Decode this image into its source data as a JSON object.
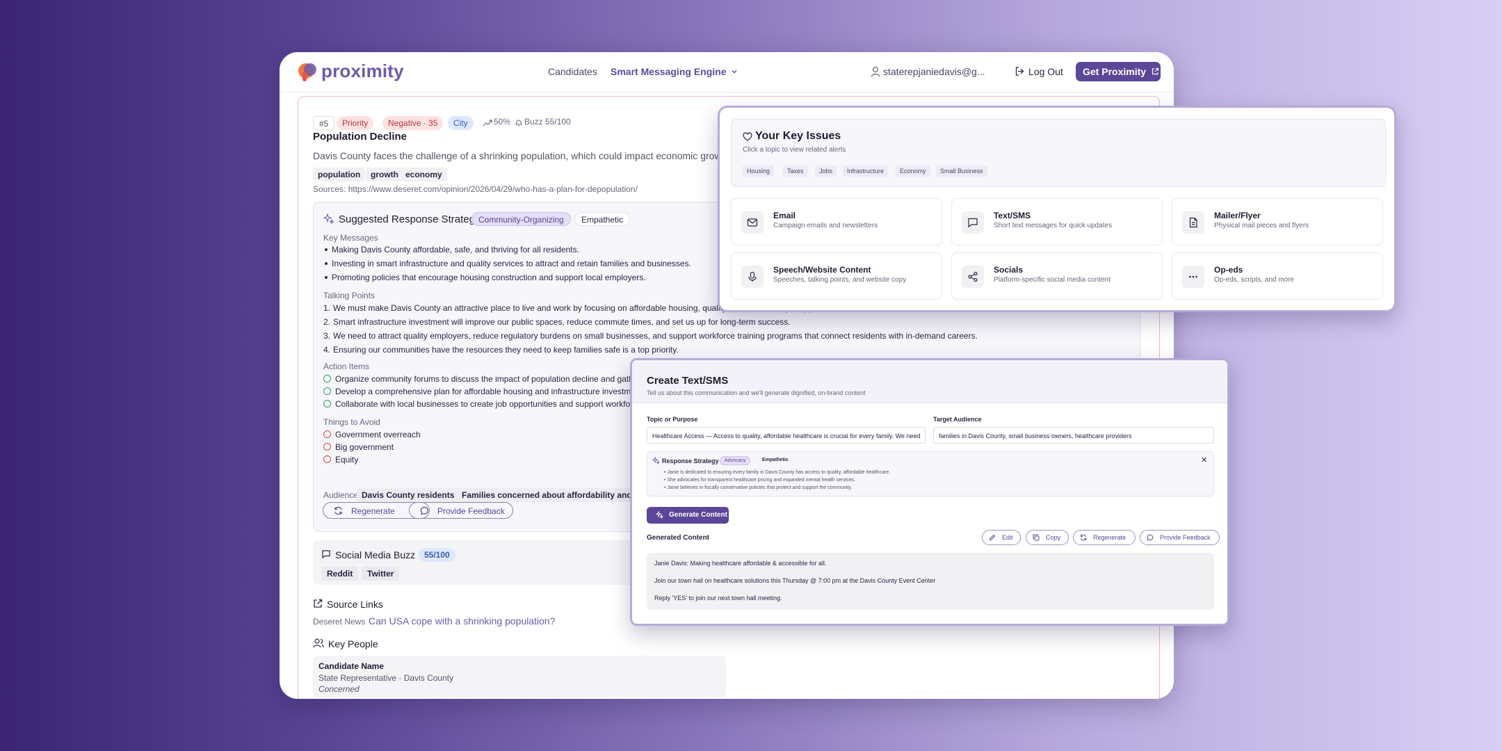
{
  "nav": {
    "logo": "proximity",
    "links": [
      "Candidates",
      "Smart Messaging Engine"
    ],
    "user": "staterepjaniedavis@g...",
    "logout": "Log Out",
    "cta": "Get Proximity"
  },
  "issue": {
    "number": "#5",
    "tags": [
      "Priority",
      "Negative · 35",
      "City"
    ],
    "trend": "50%",
    "buzz": "Buzz 55/100",
    "title": "Population Decline",
    "description": "Davis County faces the challenge of a shrinking population, which could impact economic growth",
    "keywords": [
      "population",
      "growth",
      "economy"
    ],
    "sources": "Sources: https://www.deseret.com/opinion/2026/04/29/who-has-a-plan-for-depopulation/"
  },
  "strategy": {
    "title": "Suggested Response Strategy",
    "type": "Community-Organizing",
    "tone": "Empathetic",
    "key_messages_label": "Key Messages",
    "key_messages": [
      "Making Davis County affordable, safe, and thriving for all residents.",
      "Investing in smart infrastructure and quality services to attract and retain families and businesses.",
      "Promoting policies that encourage housing construction and support local employers."
    ],
    "talking_points_label": "Talking Points",
    "talking_points": [
      "We must make Davis County an attractive place to live and work by focusing on affordable housing, quality education, and job opportunities.",
      "Smart infrastructure investment will improve our public spaces, reduce commute times, and set us up for long-term success.",
      "We need to attract quality employers, reduce regulatory burdens on small businesses, and support workforce training programs that connect residents with in-demand careers.",
      "Ensuring our communities have the resources they need to keep families safe is a top priority."
    ],
    "action_items_label": "Action Items",
    "action_items": [
      "Organize community forums to discuss the impact of population decline and gather",
      "Develop a comprehensive plan for affordable housing and infrastructure investment",
      "Collaborate with local businesses to create job opportunities and support workforce"
    ],
    "avoid_label": "Things to Avoid",
    "avoid": [
      "Government overreach",
      "Big government",
      "Equity"
    ],
    "audience_label": "Audience:",
    "audience": [
      "Davis County residents",
      "Families concerned about affordability and safe"
    ],
    "regenerate": "Regenerate",
    "feedback": "Provide Feedback"
  },
  "social": {
    "title": "Social Media Buzz",
    "score": "55/100",
    "platforms": [
      "Reddit",
      "Twitter"
    ]
  },
  "source_links": {
    "title": "Source Links",
    "publisher": "Deseret News",
    "link": "Can USA cope with a shrinking population?"
  },
  "key_people": {
    "title": "Key People",
    "name": "Candidate Name",
    "role": "State Representative · Davis County",
    "stance": "Concerned"
  },
  "key_issues": {
    "title": "Your Key Issues",
    "subtitle": "Click a topic to view related alerts",
    "tags": [
      "Housing",
      "Taxes",
      "Jobs",
      "Infrastructure",
      "Economy",
      "Small Business"
    ],
    "cards": [
      {
        "title": "Email",
        "sub": "Campaign emails and newsletters",
        "icon": "mail-icon"
      },
      {
        "title": "Text/SMS",
        "sub": "Short text messages for quick updates",
        "icon": "message-icon"
      },
      {
        "title": "Mailer/Flyer",
        "sub": "Physical mail pieces and flyers",
        "icon": "document-icon"
      },
      {
        "title": "Speech/Website Content",
        "sub": "Speeches, talking points, and website copy",
        "icon": "microphone-icon"
      },
      {
        "title": "Socials",
        "sub": "Platform-specific social media content",
        "icon": "share-icon"
      },
      {
        "title": "Op-eds",
        "sub": "Op-eds, scripts, and more",
        "icon": "more-icon"
      }
    ]
  },
  "sms": {
    "title": "Create Text/SMS",
    "subtitle": "Tell us about this communication and we'll generate dignified, on-brand content",
    "topic_label": "Topic or Purpose",
    "topic_value": "Healthcare Access — Access to quality, affordable healthcare is crucial for every family. We need",
    "audience_label": "Target Audience",
    "audience_value": "families in Davis County, small business owners, healthcare providers",
    "strategy_label": "Response Strategy",
    "strategy_type": "Advocacy",
    "strategy_tone": "Empathetic",
    "strategy_points": [
      "Janie is dedicated to ensuring every family in Davis County has access to quality, affordable healthcare.",
      "She advocates for transparent healthcare pricing and expanded mental health services.",
      "Janie believes in fiscally conservative policies that protect and support the community."
    ],
    "generate": "Generate Content",
    "generated_label": "Generated Content",
    "actions": [
      "Edit",
      "Copy",
      "Regenerate",
      "Provide Feedback"
    ],
    "generated_lines": [
      "Janie Davis: Making healthcare affordable & accessible for all.",
      "Join our town hall on healthcare solutions this Thursday @ 7:00 pm at the Davis County Event Center",
      "Reply 'YES' to join our next town hall meeting."
    ]
  },
  "colors": {
    "brand": "#5b4697",
    "priority": "#b23b3b",
    "city": "#3b5bb5",
    "success": "#2f9e58",
    "danger": "#d9473e"
  }
}
